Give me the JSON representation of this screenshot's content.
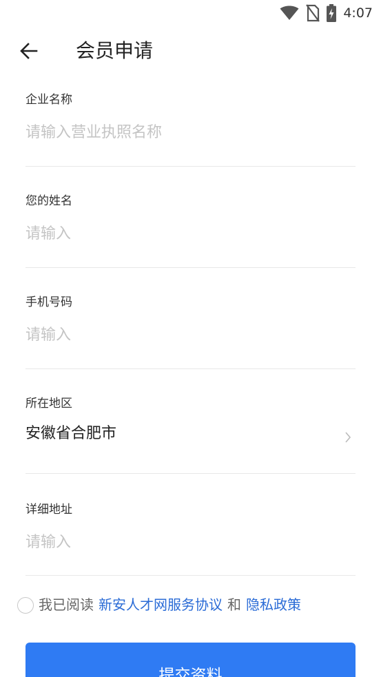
{
  "status_bar": {
    "time": "4:07",
    "icons": [
      "wifi-icon",
      "no-sim-icon",
      "battery-charging-icon"
    ]
  },
  "header": {
    "back_icon": "arrow-left-icon",
    "title": "会员申请"
  },
  "form": {
    "company_name": {
      "label": "企业名称",
      "placeholder": "请输入营业执照名称",
      "value": ""
    },
    "your_name": {
      "label": "您的姓名",
      "placeholder": "请输入",
      "value": ""
    },
    "phone": {
      "label": "手机号码",
      "placeholder": "请输入",
      "value": ""
    },
    "region": {
      "label": "所在地区",
      "value": "安徽省合肥市",
      "icon": "chevron-right-icon"
    },
    "address": {
      "label": "详细地址",
      "placeholder": "请输入",
      "value": ""
    }
  },
  "agreement": {
    "checked": false,
    "prefix": "我已阅读",
    "service_link": "新安人才网服务协议",
    "conjunction": "和",
    "privacy_link": "隐私政策"
  },
  "submit": {
    "label": "提交资料"
  },
  "colors": {
    "accent": "#2f7bf3",
    "link": "#2a6bd6",
    "placeholder": "#c4c4c4",
    "divider": "#e8e8e8"
  }
}
